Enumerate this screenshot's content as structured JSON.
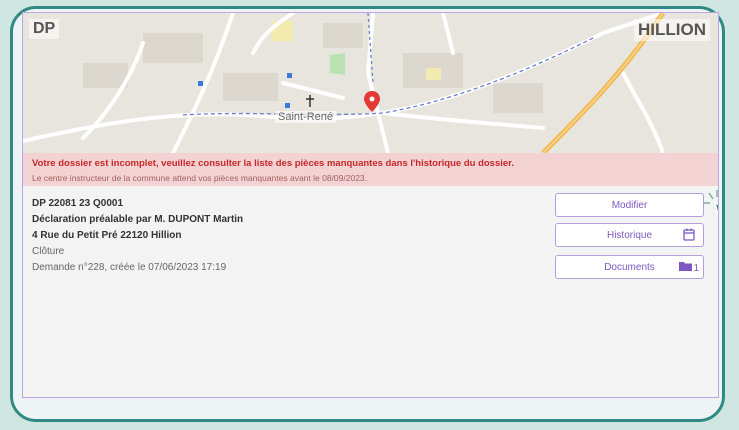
{
  "header": {
    "type_code": "DP",
    "commune": "HILLION"
  },
  "map": {
    "place_label": "Saint-René"
  },
  "alert": {
    "title": "Votre dossier est incomplet, veuillez consulter la liste des pièces manquantes dans l'historique du dossier.",
    "subtitle": "Le centre instructeur de la commune attend vos pièces manquantes avant le 08/09/2023."
  },
  "dossier": {
    "reference": "DP 22081 23 Q0001",
    "declaration": "Déclaration préalable par M. DUPONT Martin",
    "address": "4 Rue du Petit Pré 22120 Hillion",
    "object": "Clôture",
    "request": "Demande n°228, créée le 07/06/2023 17:19"
  },
  "actions": {
    "modify_label": "Modifier",
    "history_label": "Historique",
    "documents_label": "Documents",
    "documents_count": "1"
  },
  "colors": {
    "frame": "#2f8a83",
    "accent": "#7e57c2",
    "alert_bg": "#f2d2d2",
    "alert_text": "#c62828"
  }
}
